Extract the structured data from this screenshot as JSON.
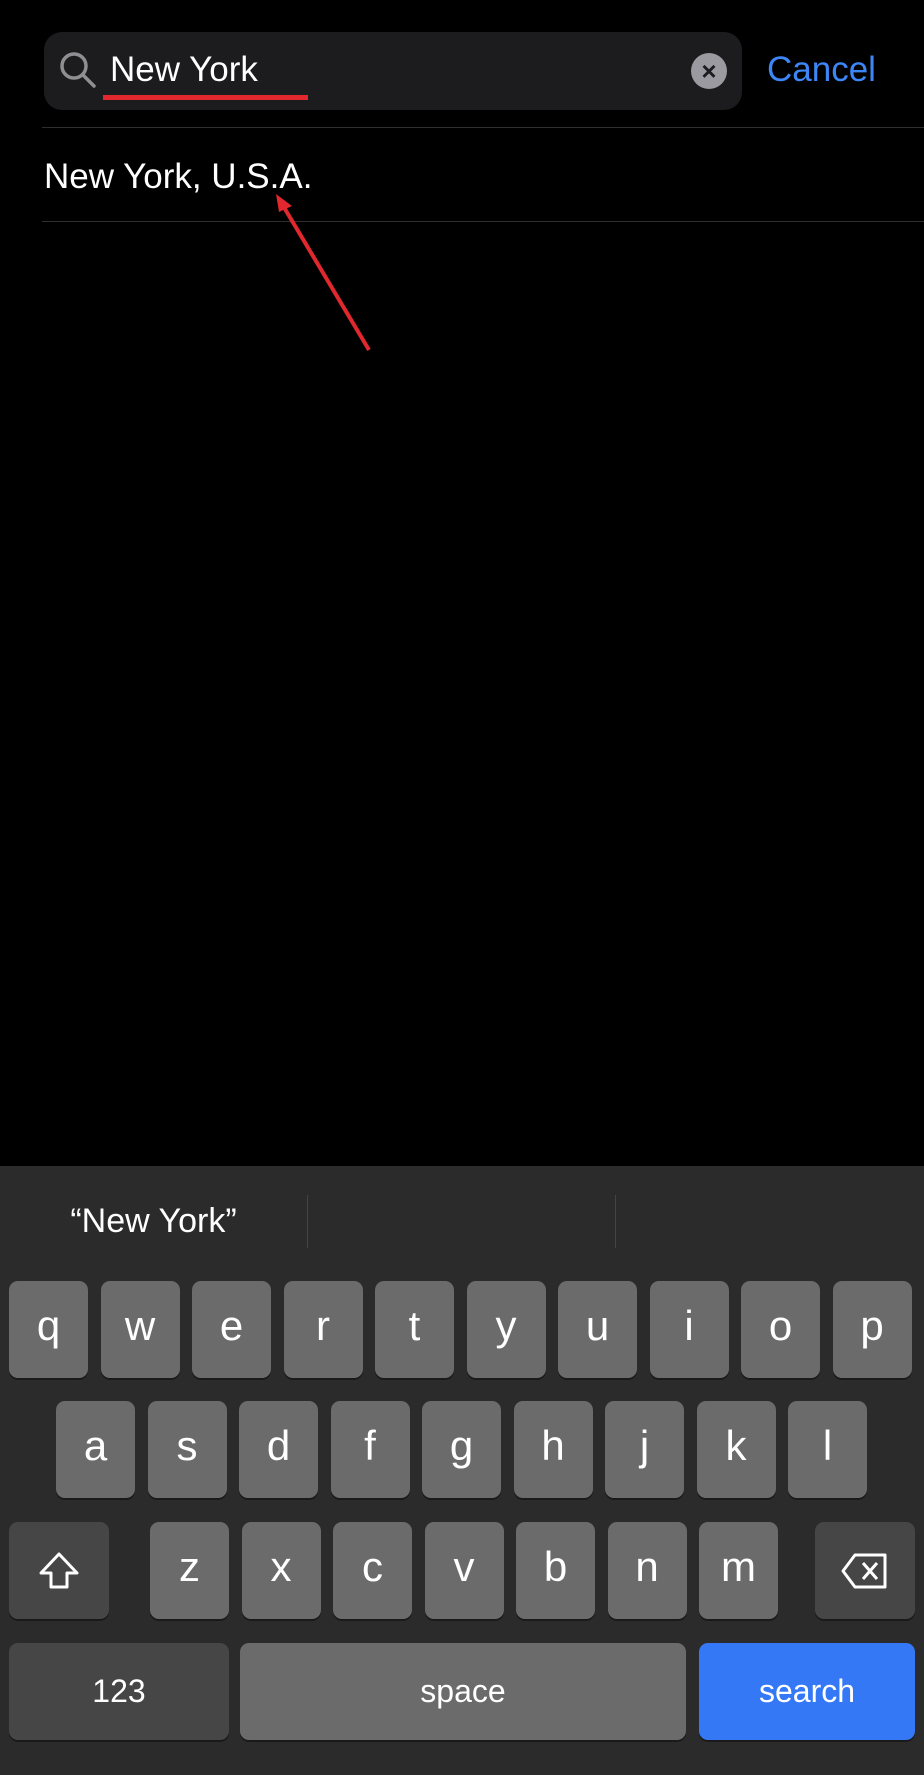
{
  "search": {
    "value": "New York",
    "clear_icon": "clear-circle-icon",
    "cancel_label": "Cancel"
  },
  "results": [
    {
      "label": "New York, U.S.A."
    }
  ],
  "annotations": {
    "underline_color": "#e0282e",
    "arrow_color": "#e0282e"
  },
  "keyboard": {
    "suggestion": "“New York”",
    "row1": [
      "q",
      "w",
      "e",
      "r",
      "t",
      "y",
      "u",
      "i",
      "o",
      "p"
    ],
    "row2": [
      "a",
      "s",
      "d",
      "f",
      "g",
      "h",
      "j",
      "k",
      "l"
    ],
    "row3": [
      "z",
      "x",
      "c",
      "v",
      "b",
      "n",
      "m"
    ],
    "numbers_label": "123",
    "space_label": "space",
    "search_label": "search",
    "accent": "#3478f6"
  }
}
